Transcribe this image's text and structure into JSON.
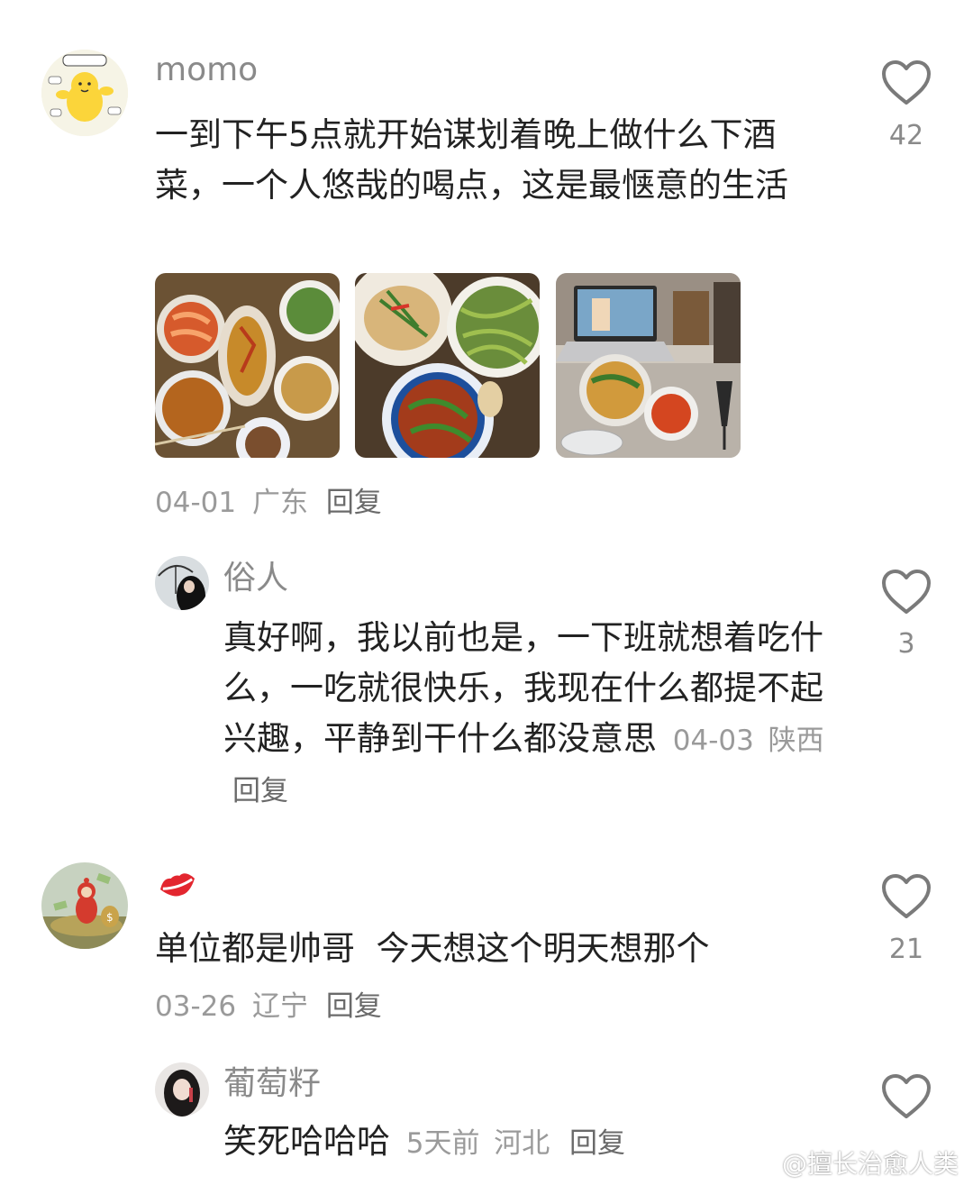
{
  "comments": [
    {
      "user": "momo",
      "avatar": "avatar-yellow-cartoon",
      "text": "一到下午5点就开始谋划着晚上做什么下酒菜，一个人悠哉的喝点，这是最惬意的生活",
      "date": "04-01",
      "location": "广东",
      "reply_label": "回复",
      "likes": "42",
      "photos": [
        "photo-seafood-dinner",
        "photo-fish-and-beans",
        "photo-laptop-table"
      ],
      "replies": [
        {
          "user": "俗人",
          "avatar": "avatar-girl-umbrella",
          "text": "真好啊，我以前也是，一下班就想着吃什么，一吃就很快乐，我现在什么都提不起兴趣，平静到干什么都没意思",
          "date": "04-03",
          "location": "陕西",
          "reply_label": "回复",
          "likes": "3"
        }
      ]
    },
    {
      "user": "",
      "user_icon": "red-lips-icon",
      "avatar": "avatar-teletubby-money",
      "text": "单位都是帅哥  今天想这个明天想那个",
      "date": "03-26",
      "location": "辽宁",
      "reply_label": "回复",
      "likes": "21",
      "replies": [
        {
          "user": "葡萄籽",
          "avatar": "avatar-dark-hair-girl",
          "text": "笑死哈哈哈",
          "date": "5天前",
          "location": "河北",
          "reply_label": "回复",
          "likes": ""
        }
      ]
    }
  ],
  "watermark": "@擅长治愈人类",
  "colors": {
    "heart": "#7a7a7a",
    "lips": "#e3262f",
    "text": "#222222",
    "meta": "#9a9a9a"
  }
}
